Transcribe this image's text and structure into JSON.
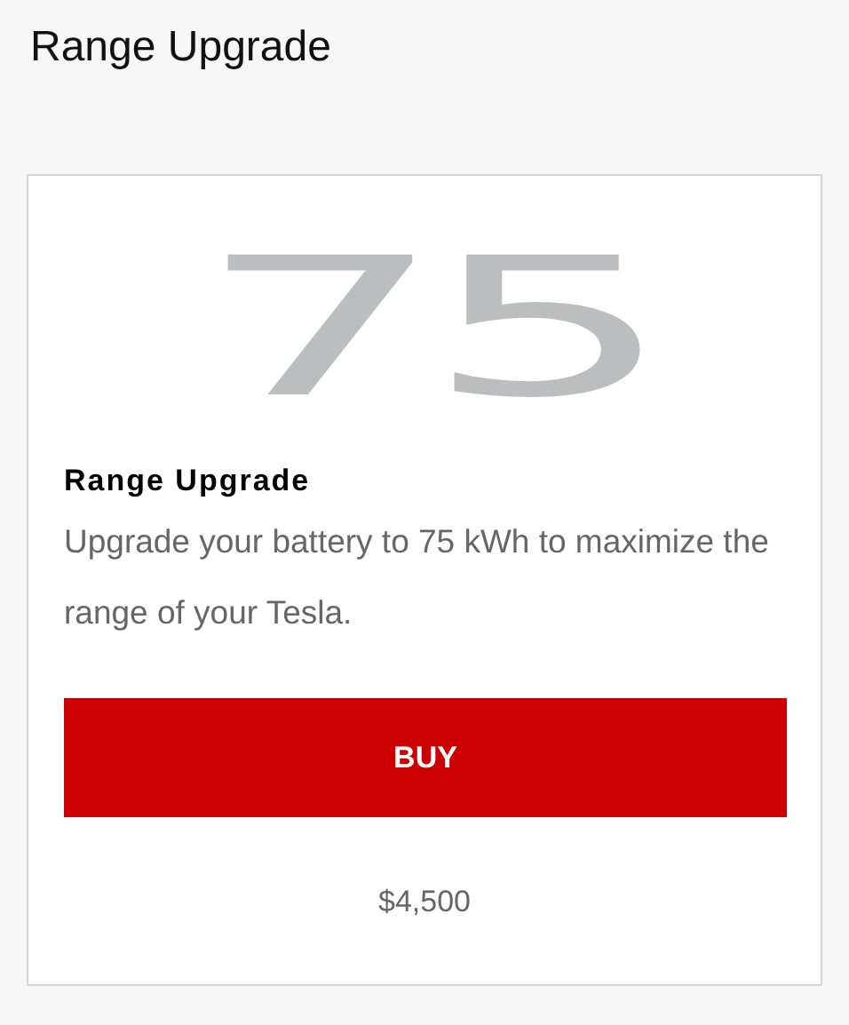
{
  "page_title": "Range Upgrade",
  "card": {
    "badge": "75",
    "heading": "Range Upgrade",
    "description": "Upgrade your battery to 75 kWh to maximize the range of your Tesla.",
    "button": "BUY",
    "price": "$4,500"
  }
}
